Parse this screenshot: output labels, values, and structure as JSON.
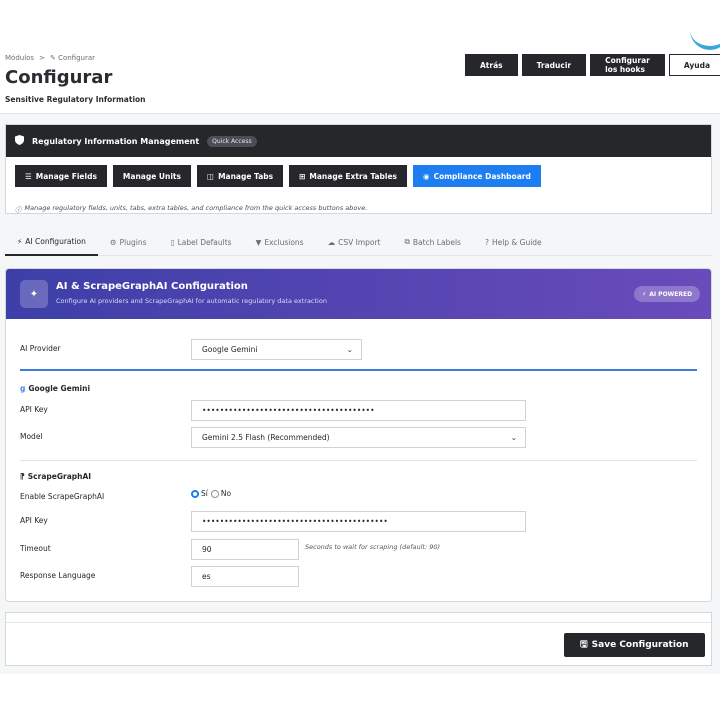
{
  "breadcrumb": {
    "parent": "Módulos",
    "separator": ">",
    "current": "Configurar",
    "current_icon": "wrench-icon"
  },
  "header": {
    "title": "Configurar",
    "subtitle": "Sensitive Regulatory Information",
    "buttons": [
      "Atrás",
      "Traducir",
      "Configurar los hooks",
      "Ayuda"
    ]
  },
  "quick_access": {
    "title": "Regulatory Information Management",
    "badge": "Quick Access",
    "buttons": [
      {
        "label": "Manage Fields",
        "icon": "list-icon"
      },
      {
        "label": "Manage Units",
        "icon": ""
      },
      {
        "label": "Manage Tabs",
        "icon": "window-icon"
      },
      {
        "label": "Manage Extra Tables",
        "icon": "table-icon"
      },
      {
        "label": "Compliance Dashboard",
        "icon": "dashboard-icon"
      }
    ],
    "note": "Manage regulatory fields, units, tabs, extra tables, and compliance from the quick access buttons above."
  },
  "tabs": [
    {
      "label": "AI Configuration",
      "icon": "wand-icon",
      "active": true
    },
    {
      "label": "Plugins",
      "icon": "plug-icon"
    },
    {
      "label": "Label Defaults",
      "icon": "file-icon"
    },
    {
      "label": "Exclusions",
      "icon": "filter-icon"
    },
    {
      "label": "CSV Import",
      "icon": "cloud-upload-icon"
    },
    {
      "label": "Batch Labels",
      "icon": "tags-icon"
    },
    {
      "label": "Help & Guide",
      "icon": "question-icon"
    }
  ],
  "ai_section": {
    "title": "AI & ScrapeGraphAI Configuration",
    "subtitle": "Configure AI providers and ScrapeGraphAI for automatic regulatory data extraction",
    "badge": "AI POWERED",
    "provider_label": "AI Provider",
    "provider_value": "Google Gemini",
    "gemini": {
      "title": "Google Gemini",
      "api_key_label": "API Key",
      "api_key_value": "•••••••••••••••••••••••••••••••••••••••",
      "model_label": "Model",
      "model_value": "Gemini 2.5 Flash (Recommended)"
    },
    "scrape": {
      "title": "ScrapeGraphAI",
      "enable_label": "Enable ScrapeGraphAI",
      "yes_label": "Sí",
      "no_label": "No",
      "enabled": true,
      "api_key_label": "API Key",
      "api_key_value": "••••••••••••••••••••••••••••••••••••••••••",
      "timeout_label": "Timeout",
      "timeout_value": "90",
      "timeout_help": "Seconds to wait for scraping (default: 90)",
      "language_label": "Response Language",
      "language_value": "es"
    }
  },
  "save_button": "Save Configuration",
  "colors": {
    "dark": "#25272b",
    "primary": "#1c7ef0",
    "gradient_start": "#3d3fa8",
    "gradient_end": "#6a4bbb"
  }
}
